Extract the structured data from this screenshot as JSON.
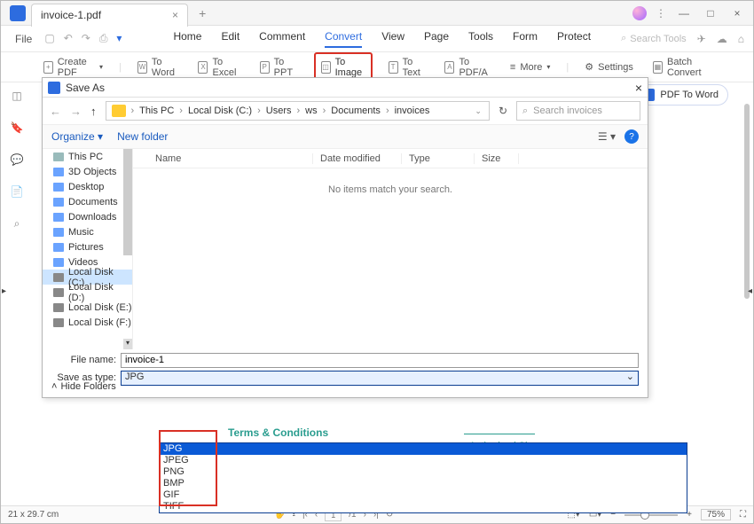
{
  "titlebar": {
    "tab_label": "invoice-1.pdf"
  },
  "row2": {
    "file": "File",
    "tabs": [
      "Home",
      "Edit",
      "Comment",
      "Convert",
      "View",
      "Page",
      "Tools",
      "Form",
      "Protect"
    ],
    "active_tab": "Convert",
    "search_tools": "Search Tools"
  },
  "toolbar": {
    "create": "Create PDF",
    "to_word": "To Word",
    "to_excel": "To Excel",
    "to_ppt": "To PPT",
    "to_image": "To Image",
    "to_text": "To Text",
    "to_pdfa": "To PDF/A",
    "more": "More",
    "settings": "Settings",
    "batch": "Batch Convert"
  },
  "right_button": "PDF To Word",
  "dialog": {
    "title": "Save As",
    "breadcrumb": [
      "This PC",
      "Local Disk (C:)",
      "Users",
      "ws",
      "Documents",
      "invoices"
    ],
    "search_placeholder": "Search invoices",
    "organize": "Organize",
    "new_folder": "New folder",
    "tree": [
      "This PC",
      "3D Objects",
      "Desktop",
      "Documents",
      "Downloads",
      "Music",
      "Pictures",
      "Videos",
      "Local Disk (C:)",
      "Local Disk (D:)",
      "Local Disk (E:)",
      "Local Disk (F:)"
    ],
    "tree_selected": "Local Disk (C:)",
    "cols": {
      "name": "Name",
      "date": "Date modified",
      "type": "Type",
      "size": "Size"
    },
    "empty": "No items match your search.",
    "file_name_label": "File name:",
    "file_name_value": "invoice-1",
    "save_type_label": "Save as type:",
    "save_type_value": "JPG",
    "hide_folders": "Hide Folders",
    "options": [
      "JPG",
      "JPEG",
      "PNG",
      "BMP",
      "GIF",
      "TIFF"
    ]
  },
  "doc": {
    "terms": "Terms & Conditions",
    "auth": "Authorised Sign"
  },
  "statusbar": {
    "dims": "21 x 29.7 cm",
    "page": "1",
    "pages": "/1",
    "zoom": "75%"
  }
}
